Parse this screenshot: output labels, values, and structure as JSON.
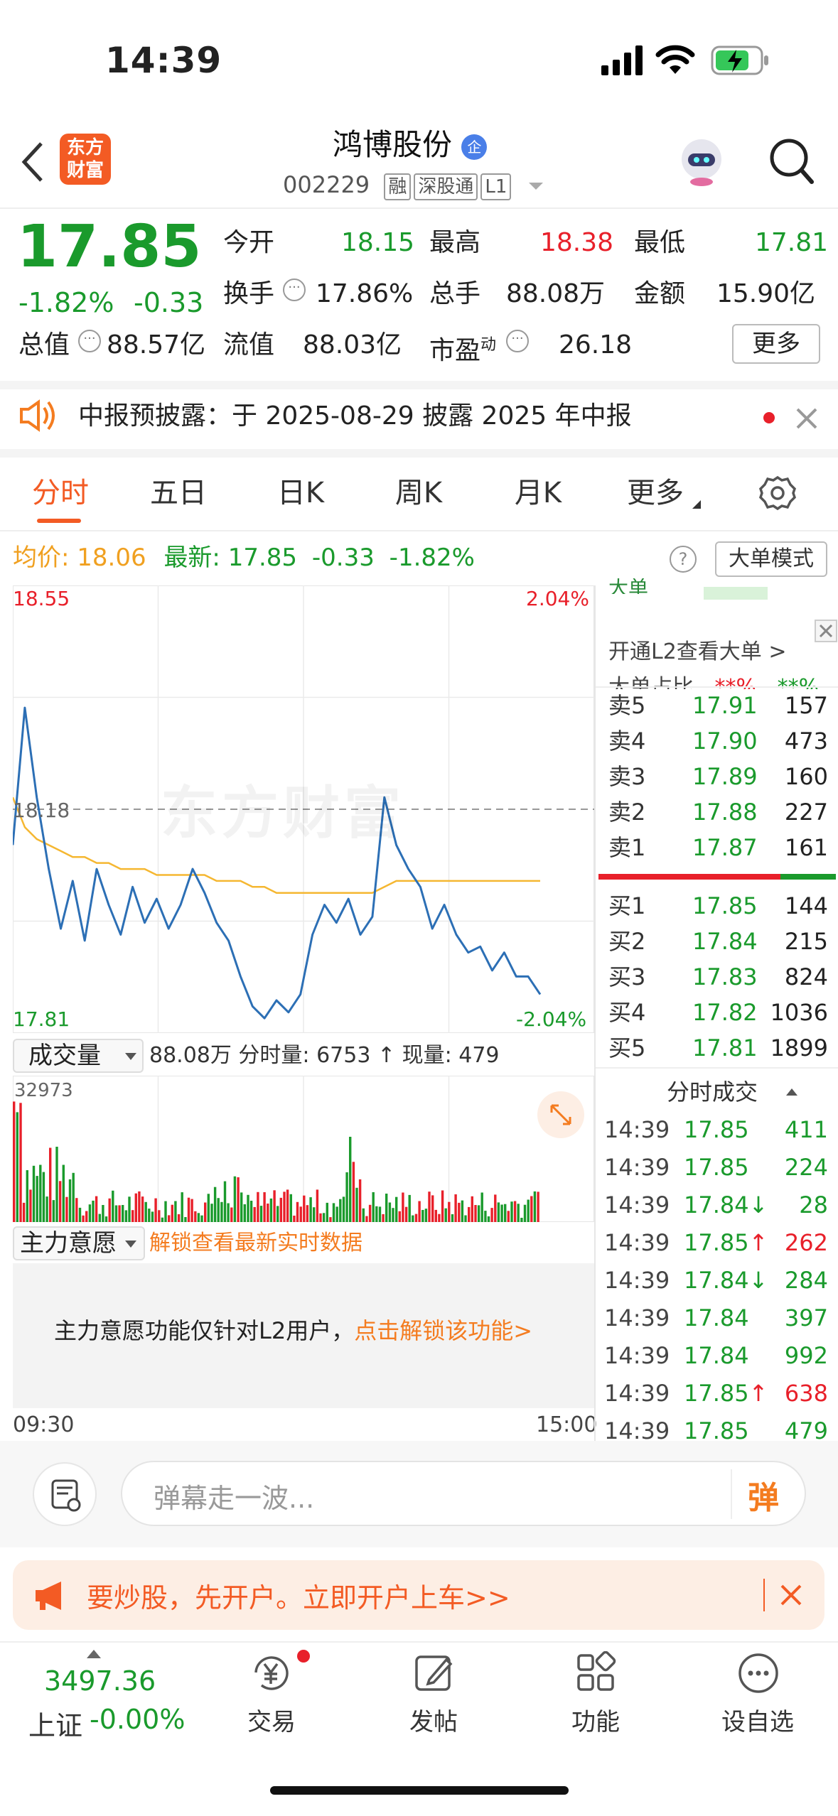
{
  "status": {
    "time": "14:39"
  },
  "header": {
    "title": "鸿博股份",
    "badge": "企",
    "code": "002229",
    "tags": [
      "融",
      "深股通",
      "L1"
    ],
    "logo_line1": "东方",
    "logo_line2": "财富"
  },
  "quote": {
    "price": "17.85",
    "pct": "-1.82%",
    "chg": "-0.33",
    "open_label": "今开",
    "open": "18.15",
    "high_label": "最高",
    "high": "18.38",
    "low_label": "最低",
    "low": "17.81",
    "turnover_label": "换手",
    "turnover": "17.86%",
    "vol_label": "总手",
    "vol": "88.08万",
    "amount_label": "金额",
    "amount": "15.90亿",
    "mktcap_label": "总值",
    "mktcap": "88.57亿",
    "float_label": "流值",
    "float": "88.03亿",
    "pe_label": "市盈",
    "pe_sup": "动",
    "pe": "26.18",
    "more": "更多"
  },
  "notice": {
    "text": "中报预披露：于 2025-08-29 披露 2025 年中报"
  },
  "tabs": [
    "分时",
    "五日",
    "日K",
    "周K",
    "月K",
    "更多"
  ],
  "infobar": {
    "avg_label": "均价:",
    "avg": "18.06",
    "last_label": "最新:",
    "last": "17.85",
    "chg": "-0.33",
    "pct": "-1.82%",
    "mode": "大单模式"
  },
  "chart": {
    "ymax_label": "18.55",
    "ymin_label": "17.81",
    "pct_top": "2.04%",
    "pct_bottom": "-2.04%",
    "ref_label": "18.18",
    "watermark": "东方财富",
    "start_time": "09:30",
    "end_time": "15:00"
  },
  "chart_data": {
    "type": "line",
    "ylim": [
      17.81,
      18.55
    ],
    "reference": 18.18,
    "series": [
      {
        "values": [
          18.12,
          18.35,
          18.2,
          18.08,
          17.98,
          18.06,
          17.96,
          18.08,
          18.02,
          17.97,
          18.05,
          17.99,
          18.03,
          17.98,
          18.02,
          18.08,
          18.04,
          17.99,
          17.96,
          17.9,
          17.85,
          17.83,
          17.86,
          17.84,
          17.87,
          17.97,
          18.02,
          17.99,
          18.03,
          17.97,
          18.0,
          18.2,
          18.12,
          18.08,
          18.05,
          17.98,
          18.02,
          17.97,
          17.94,
          17.95,
          17.91,
          17.94,
          17.9,
          17.9,
          17.87
        ]
      },
      {
        "values": [
          18.2,
          18.15,
          18.13,
          18.12,
          18.11,
          18.1,
          18.1,
          18.09,
          18.09,
          18.08,
          18.08,
          18.08,
          18.07,
          18.07,
          18.07,
          18.07,
          18.07,
          18.06,
          18.06,
          18.06,
          18.05,
          18.05,
          18.04,
          18.04,
          18.04,
          18.04,
          18.04,
          18.04,
          18.04,
          18.04,
          18.04,
          18.05,
          18.06,
          18.06,
          18.06,
          18.06,
          18.06,
          18.06,
          18.06,
          18.06,
          18.06,
          18.06,
          18.06,
          18.06,
          18.06
        ]
      }
    ]
  },
  "volume": {
    "label": "成交量",
    "summary": "88.08万 分时量: 6753 ↑ 现量: 479",
    "max": "32973"
  },
  "mainforce": {
    "label": "主力意愿",
    "unlock": "解锁查看最新实时数据",
    "desc": "主力意愿功能仅针对L2用户，",
    "link": "点击解锁该功能>"
  },
  "orderbook": {
    "l2_text": "开通L2查看大单 >",
    "top_label": "大单",
    "ratio_label": "大单占比",
    "ratio_vals": [
      "**%",
      "**%"
    ],
    "asks": [
      {
        "label": "卖5",
        "price": "17.91",
        "vol": "157"
      },
      {
        "label": "卖4",
        "price": "17.90",
        "vol": "473"
      },
      {
        "label": "卖3",
        "price": "17.89",
        "vol": "160"
      },
      {
        "label": "卖2",
        "price": "17.88",
        "vol": "227"
      },
      {
        "label": "卖1",
        "price": "17.87",
        "vol": "161"
      }
    ],
    "bids": [
      {
        "label": "买1",
        "price": "17.85",
        "vol": "144"
      },
      {
        "label": "买2",
        "price": "17.84",
        "vol": "215"
      },
      {
        "label": "买3",
        "price": "17.83",
        "vol": "824"
      },
      {
        "label": "买4",
        "price": "17.82",
        "vol": "1036"
      },
      {
        "label": "买5",
        "price": "17.81",
        "vol": "1899"
      }
    ]
  },
  "ticks": {
    "title": "分时成交",
    "rows": [
      {
        "time": "14:39",
        "price": "17.85",
        "vol": "411",
        "dir": "",
        "vc": "green"
      },
      {
        "time": "14:39",
        "price": "17.85",
        "vol": "224",
        "dir": "",
        "vc": "green"
      },
      {
        "time": "14:39",
        "price": "17.84↓",
        "vol": "28",
        "dir": "down",
        "vc": "green"
      },
      {
        "time": "14:39",
        "price": "17.85↑",
        "vol": "262",
        "dir": "up",
        "vc": "red"
      },
      {
        "time": "14:39",
        "price": "17.84↓",
        "vol": "284",
        "dir": "down",
        "vc": "green"
      },
      {
        "time": "14:39",
        "price": "17.84",
        "vol": "397",
        "dir": "",
        "vc": "green"
      },
      {
        "time": "14:39",
        "price": "17.84",
        "vol": "992",
        "dir": "",
        "vc": "green"
      },
      {
        "time": "14:39",
        "price": "17.85↑",
        "vol": "638",
        "dir": "up",
        "vc": "red"
      },
      {
        "time": "14:39",
        "price": "17.85",
        "vol": "479",
        "dir": "",
        "vc": "green"
      }
    ]
  },
  "comment": {
    "placeholder": "弹幕走一波...",
    "danmu": "弹"
  },
  "promo": {
    "text": "要炒股，先开户。立即开户上车>>"
  },
  "bottomnav": {
    "index_value": "3497.36",
    "index_name": "上证",
    "index_pct": "-0.00%",
    "items": [
      "交易",
      "发帖",
      "功能",
      "设自选"
    ]
  },
  "colors": {
    "up": "#e8202a",
    "down": "#1a9a2c",
    "accent": "#f47c20",
    "line": "#2c6fb5",
    "avg": "#f5b731"
  }
}
